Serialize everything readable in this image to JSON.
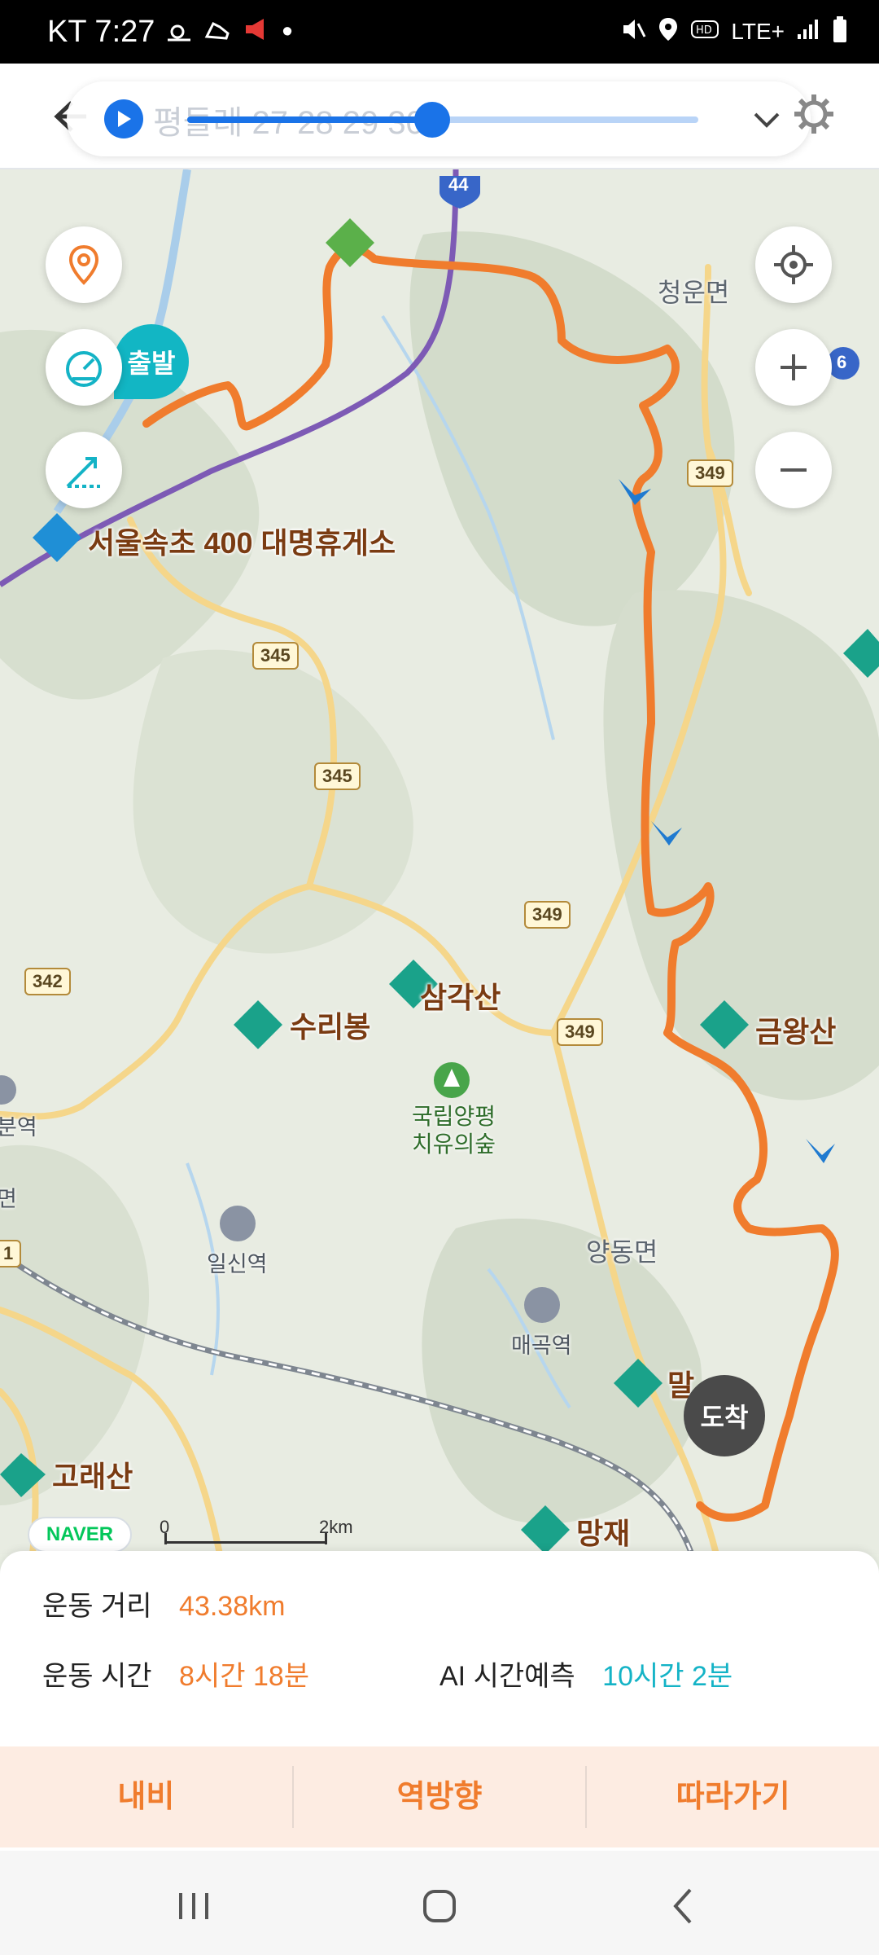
{
  "status_bar": {
    "carrier_time": "KT 7:27",
    "network": "LTE+",
    "dot": "•"
  },
  "header": {
    "course_title": "평들레 27 28 29 30",
    "progress_fraction": 0.48
  },
  "map": {
    "places": [
      {
        "key": "rest",
        "text": "서울속초 400 대명휴게소"
      },
      {
        "key": "samgaksan",
        "text": "삼각산"
      },
      {
        "key": "suribong",
        "text": "수리봉"
      },
      {
        "key": "geumwangsan",
        "text": "금왕산"
      },
      {
        "key": "goraesan",
        "text": "고래산"
      },
      {
        "key": "mangjae",
        "text": "망재"
      },
      {
        "key": "mal",
        "text": "말"
      }
    ],
    "towns": {
      "cheongun": "청운면",
      "yangdong": "양동면"
    },
    "stations": {
      "ilsin": "일신역",
      "maegok": "매곡역",
      "left_partial": "분역",
      "left_partial2": "면"
    },
    "forest_line1": "국립양평",
    "forest_line2": "치유의숲",
    "roads": {
      "r44": "44",
      "r6": "6",
      "r349a": "349",
      "r349b": "349",
      "r349c": "349",
      "r345a": "345",
      "r345b": "345",
      "r342": "342",
      "r1": "1"
    },
    "start_label": "출발",
    "end_label": "도착",
    "naver": "NAVER",
    "scale_zero": "0",
    "scale_max": "2km"
  },
  "stats": {
    "distance_label": "운동 거리",
    "distance_value": "43.38km",
    "time_label": "운동 시간",
    "time_value": "8시간 18분",
    "ai_label": "AI 시간예측",
    "ai_value": "10시간 2분"
  },
  "actions": {
    "navi": "내비",
    "reverse": "역방향",
    "follow": "따라가기"
  },
  "colors": {
    "route": "#f07c2d",
    "accent_blue": "#1a73e8",
    "teal": "#14b3c6"
  }
}
